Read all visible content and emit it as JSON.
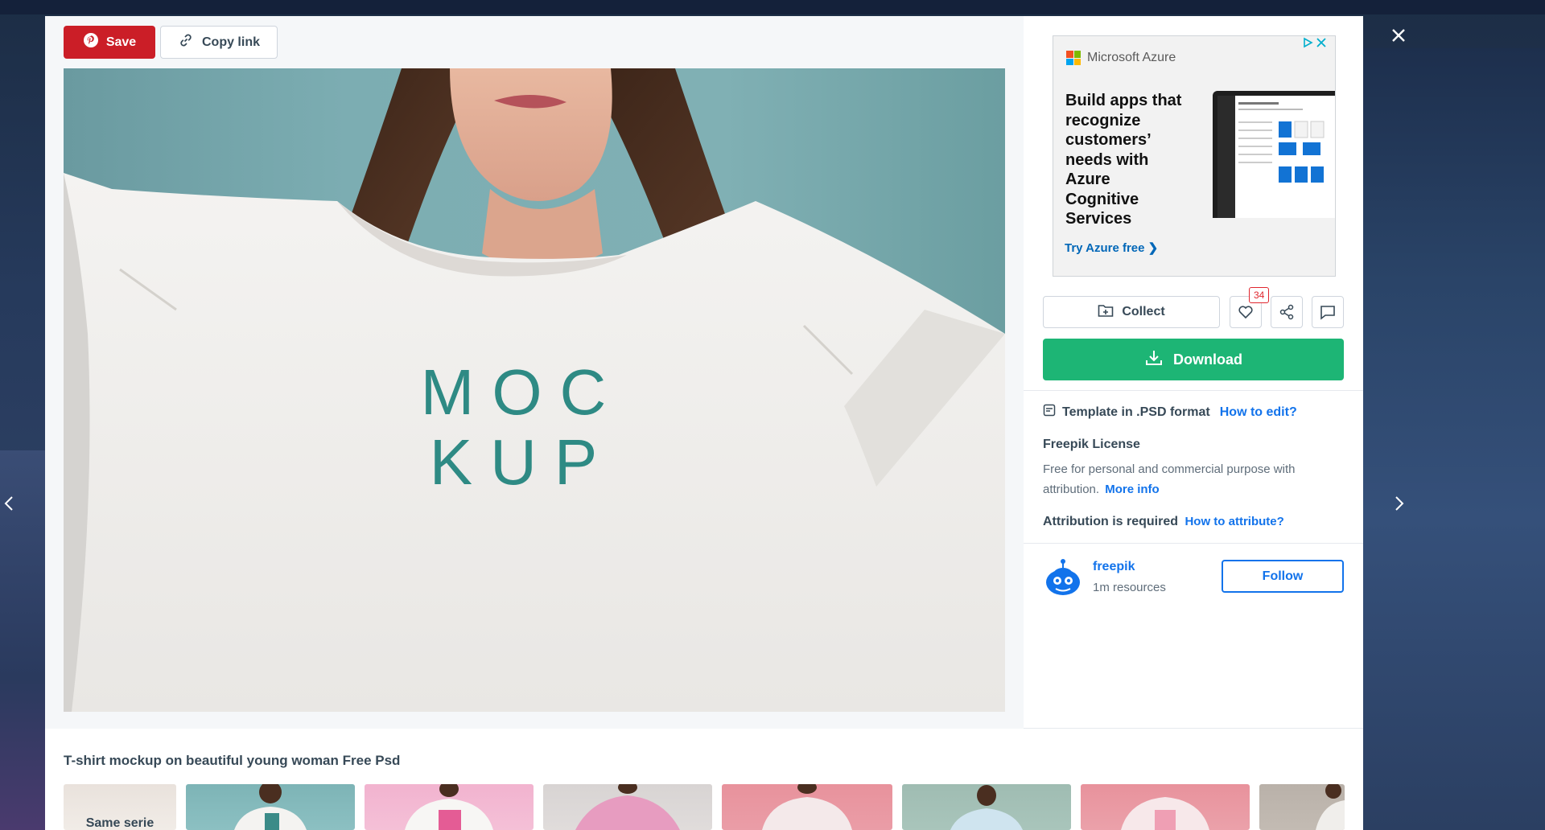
{
  "toolbar": {
    "save_label": "Save",
    "copy_link_label": "Copy link"
  },
  "image": {
    "shirt_text_line1": "MOC",
    "shirt_text_line2": "KUP"
  },
  "ad": {
    "brand": "Microsoft Azure",
    "headline": "Build apps that recognize customers’ needs with Azure Cognitive Services",
    "cta": "Try Azure free ❯",
    "colors": {
      "ms_red": "#f25022",
      "ms_green": "#7fba00",
      "ms_blue": "#00a4ef",
      "ms_yellow": "#ffb900",
      "link": "#0067b8"
    }
  },
  "actions": {
    "collect_label": "Collect",
    "like_count": "34",
    "download_label": "Download"
  },
  "details": {
    "template_text": "Template in .PSD format",
    "how_to_edit": "How to edit?",
    "license_title": "Freepik License",
    "license_text": "Free for personal and commercial purpose with attribution.",
    "more_info": "More info",
    "attribution_text": "Attribution is required",
    "how_to_attribute": "How to attribute?"
  },
  "author": {
    "name": "freepik",
    "resources": "1m resources",
    "follow_label": "Follow"
  },
  "related": {
    "title": "T-shirt mockup on beautiful young woman Free Psd",
    "first_label": "Same serie"
  },
  "colors": {
    "save_red": "#cb1e27",
    "download_green": "#1db575",
    "link_blue": "#1273eb",
    "text_dark": "#374957"
  }
}
